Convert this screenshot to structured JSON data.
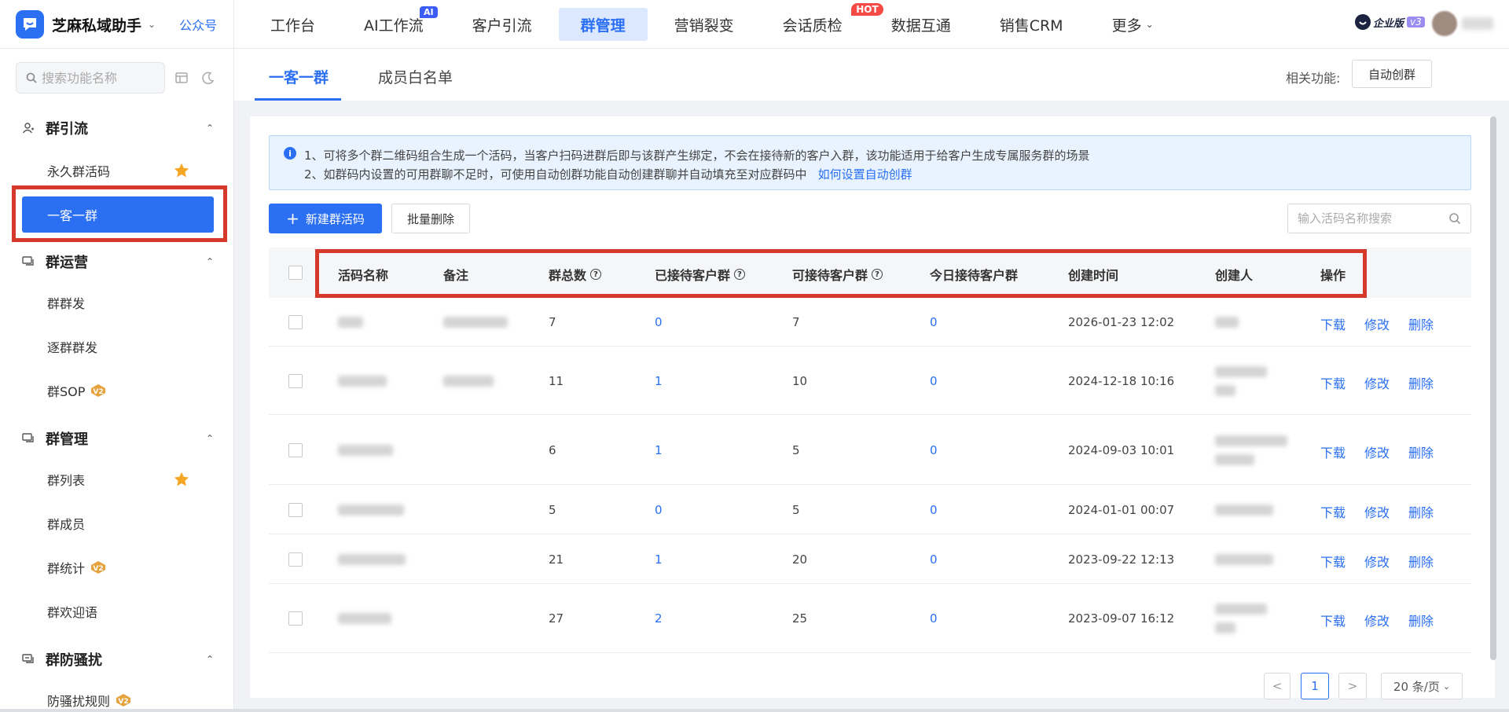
{
  "app": {
    "name": "芝麻私域助手",
    "official_account": "公众号",
    "edition": "企业版",
    "version": "v3"
  },
  "top_nav": [
    {
      "label": "工作台"
    },
    {
      "label": "AI工作流",
      "badge": "AI"
    },
    {
      "label": "客户引流"
    },
    {
      "label": "群管理",
      "active": true
    },
    {
      "label": "营销裂变"
    },
    {
      "label": "会话质检",
      "badge": "HOT"
    },
    {
      "label": "数据互通"
    },
    {
      "label": "销售CRM"
    },
    {
      "label": "更多"
    }
  ],
  "sidebar": {
    "search_placeholder": "搜索功能名称",
    "groups": [
      {
        "title": "群引流",
        "items": [
          {
            "label": "永久群活码",
            "starred": true
          },
          {
            "label": "一客一群",
            "active": true
          }
        ]
      },
      {
        "title": "群运营",
        "items": [
          {
            "label": "群群发"
          },
          {
            "label": "逐群群发"
          },
          {
            "label": "群SOP",
            "badge": "V2"
          }
        ]
      },
      {
        "title": "群管理",
        "items": [
          {
            "label": "群列表",
            "starred": true
          },
          {
            "label": "群成员"
          },
          {
            "label": "群统计",
            "badge": "V2"
          },
          {
            "label": "群欢迎语"
          }
        ]
      },
      {
        "title": "群防骚扰",
        "items": [
          {
            "label": "防骚扰规则",
            "badge": "V2"
          }
        ]
      }
    ]
  },
  "tabs": [
    {
      "label": "一客一群",
      "active": true
    },
    {
      "label": "成员白名单"
    }
  ],
  "related": {
    "label": "相关功能:",
    "button": "自动创群"
  },
  "notice": {
    "line1": "1、可将多个群二维码组合生成一个活码，当客户扫码进群后即与该群产生绑定，不会在接待新的客户入群，该功能适用于给客户生成专属服务群的场景",
    "line2": "2、如群码内设置的可用群聊不足时，可使用自动创群功能自动创建群聊并自动填充至对应群码中",
    "link": "如何设置自动创群"
  },
  "toolbar": {
    "new_button": "新建群活码",
    "batch_delete": "批量删除",
    "search_placeholder": "输入活码名称搜索"
  },
  "table": {
    "columns": [
      "活码名称",
      "备注",
      "群总数",
      "已接待客户群",
      "可接待客户群",
      "今日接待客户群",
      "创建时间",
      "创建人",
      "操作"
    ],
    "actions": [
      "下载",
      "修改",
      "删除"
    ],
    "rows": [
      {
        "total": "7",
        "received": "0",
        "available": "7",
        "today": "0",
        "created": "2026-01-23 12:02"
      },
      {
        "total": "11",
        "received": "1",
        "available": "10",
        "today": "0",
        "created": "2024-12-18 10:16"
      },
      {
        "total": "6",
        "received": "1",
        "available": "5",
        "today": "0",
        "created": "2024-09-03 10:01"
      },
      {
        "total": "5",
        "received": "0",
        "available": "5",
        "today": "0",
        "created": "2024-01-01 00:07"
      },
      {
        "total": "21",
        "received": "1",
        "available": "20",
        "today": "0",
        "created": "2023-09-22 12:13"
      },
      {
        "total": "27",
        "received": "2",
        "available": "25",
        "today": "0",
        "created": "2023-09-07 16:12"
      }
    ]
  },
  "pagination": {
    "prev": "<",
    "current": "1",
    "next": ">",
    "page_size": "20 条/页"
  },
  "colors": {
    "accent": "#2b6ff2",
    "highlight_box": "#d4392c",
    "hot_badge": "#f54a45",
    "star": "#f5a623",
    "v2_badge": "#e6a23c"
  }
}
